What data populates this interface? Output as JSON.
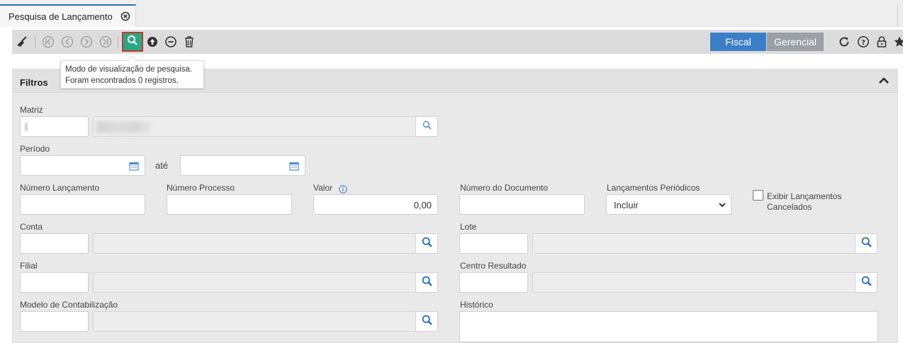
{
  "tab": {
    "title": "Pesquisa de Lançamento",
    "close_icon": "close-circle-icon"
  },
  "toolbar": {
    "icons": [
      "broom-icon",
      "first-icon",
      "prev-icon",
      "next-icon",
      "last-icon",
      "search-icon",
      "upload-icon",
      "minus-circle-icon",
      "trash-icon"
    ],
    "segments": {
      "fiscal": "Fiscal",
      "gerencial": "Gerencial"
    },
    "right_icons": [
      "refresh-icon",
      "help-icon",
      "lock-icon",
      "star-icon"
    ],
    "active_color": "#2aa884",
    "segment_active_color": "#3a7fc8"
  },
  "tooltip": {
    "line1": "Modo de visualização de pesquisa.",
    "line2": "Foram encontrados 0 registros."
  },
  "panel": {
    "title": "Filtros",
    "fields": {
      "matriz": {
        "label": "Matriz"
      },
      "periodo": {
        "label": "Período",
        "ate": "até"
      },
      "numero_lancamento": {
        "label": "Número Lançamento"
      },
      "numero_processo": {
        "label": "Número Processo"
      },
      "valor": {
        "label": "Valor",
        "value": "0,00"
      },
      "numero_documento": {
        "label": "Número do Documento"
      },
      "lancamentos_periodicos": {
        "label": "Lançamentos Periódicos",
        "selected": "Incluir"
      },
      "exibir_cancelados": {
        "label_line1": "Exibir Lançamentos",
        "label_line2": "Cancelados",
        "checked": false
      },
      "conta": {
        "label": "Conta"
      },
      "lote": {
        "label": "Lote"
      },
      "filial": {
        "label": "Filial"
      },
      "centro_resultado": {
        "label": "Centro Resultado"
      },
      "modelo_contabilizacao": {
        "label": "Modelo de Contabilização"
      },
      "historico": {
        "label": "Histórico"
      }
    }
  }
}
